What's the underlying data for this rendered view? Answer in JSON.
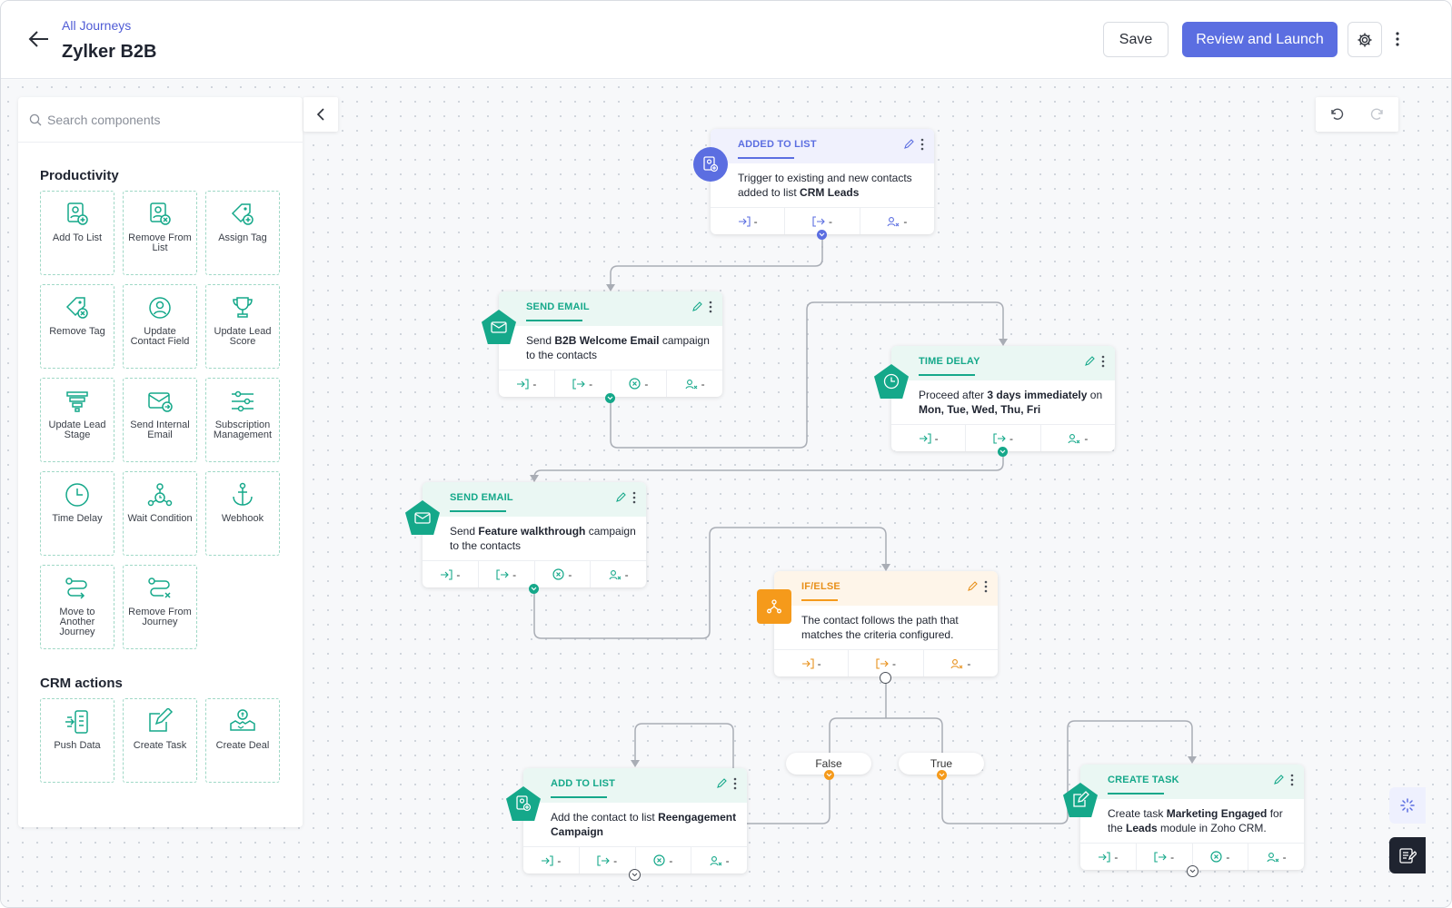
{
  "header": {
    "breadcrumb": "All Journeys",
    "title": "Zylker B2B",
    "save_label": "Save",
    "launch_label": "Review and Launch"
  },
  "sidebar": {
    "search_placeholder": "Search components",
    "sections": [
      {
        "title": "Productivity",
        "items": [
          "Add To List",
          "Remove From List",
          "Assign Tag",
          "Remove Tag",
          "Update Contact Field",
          "Update Lead Score",
          "Update Lead Stage",
          "Send Internal Email",
          "Subscription Management",
          "Time Delay",
          "Wait Condition",
          "Webhook",
          "Move to Another Journey",
          "Remove From Journey"
        ]
      },
      {
        "title": "CRM actions",
        "items": [
          "Push Data",
          "Create Task",
          "Create Deal"
        ]
      }
    ]
  },
  "nodes": [
    {
      "type": "ADDED TO LIST",
      "desc_parts": [
        "Trigger to existing and new contacts added to list ",
        "CRM Leads",
        ""
      ],
      "stats": [
        "-",
        "-",
        "-"
      ]
    },
    {
      "type": "SEND EMAIL",
      "desc_parts": [
        "Send ",
        "B2B Welcome Email",
        " campaign to the contacts"
      ],
      "stats": [
        "-",
        "-",
        "-",
        "-"
      ]
    },
    {
      "type": "TIME DELAY",
      "desc_parts": [
        "Proceed after ",
        "3 days immediately",
        " on ",
        "Mon, Tue, Wed, Thu, Fri"
      ],
      "stats": [
        "-",
        "-",
        "-"
      ]
    },
    {
      "type": "SEND EMAIL",
      "desc_parts": [
        "Send ",
        "Feature walkthrough",
        " campaign to the contacts"
      ],
      "stats": [
        "-",
        "-",
        "-",
        "-"
      ]
    },
    {
      "type": "IF/ELSE",
      "desc_parts": [
        "The contact follows the path that matches the criteria configured."
      ],
      "stats": [
        "-",
        "-",
        "-"
      ]
    },
    {
      "type": "ADD TO LIST",
      "desc_parts": [
        "Add the contact to list ",
        "Reengagement Campaign",
        ""
      ],
      "stats": [
        "-",
        "-",
        "-",
        "-"
      ]
    },
    {
      "type": "CREATE TASK",
      "desc_parts": [
        "Create task ",
        "Marketing Engaged",
        " for the ",
        "Leads",
        " module in Zoho CRM."
      ],
      "stats": [
        "-",
        "-",
        "-",
        "-"
      ]
    }
  ],
  "branches": {
    "false_label": "False",
    "true_label": "True"
  },
  "colors": {
    "accent": "#5b6ee1",
    "teal": "#15a88a",
    "orange": "#f59a1b",
    "connector": "#a9adb5"
  }
}
